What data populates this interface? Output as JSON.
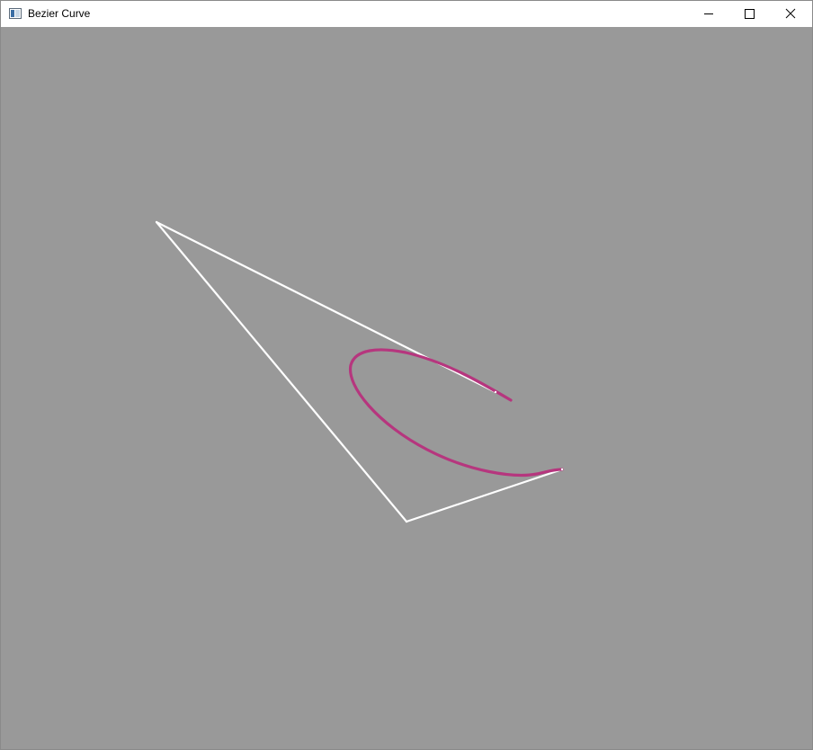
{
  "window": {
    "title": "Bezier Curve",
    "icon": "app-window-icon",
    "controls": {
      "minimize_icon": "minimize-icon",
      "maximize_icon": "maximize-icon",
      "close_icon": "close-icon"
    }
  },
  "canvas": {
    "background_color": "#999999",
    "control_polygon_color": "#ffffff",
    "curve_color": "#b6367e"
  }
}
